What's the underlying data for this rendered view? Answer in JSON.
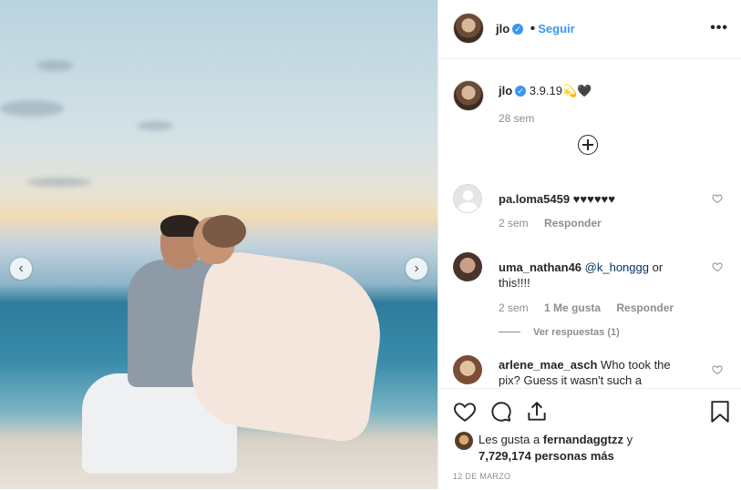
{
  "post": {
    "author": "jlo",
    "follow_label": "Seguir",
    "more_label": "•••",
    "caption": "3.9.19💫🖤",
    "caption_age": "28 sem",
    "prev_arrow": "‹",
    "next_arrow": "›"
  },
  "comments": [
    {
      "username": "pa.loma5459",
      "text": "♥♥♥♥♥♥",
      "age": "2 sem",
      "likes": "",
      "reply_label": "Responder"
    },
    {
      "username": "uma_nathan46",
      "mention": "@k_honggg",
      "text": "or this!!!!",
      "age": "2 sem",
      "likes": "1 Me gusta",
      "reply_label": "Responder",
      "view_replies": "Ver respuestas (1)"
    },
    {
      "username": "arlene_mae_asch",
      "text": "Who took the pix? Guess it wasn't such a",
      "age": "",
      "likes": "",
      "reply_label": ""
    }
  ],
  "footer": {
    "liked_prefix": "Les gusta a",
    "liked_user": "fernandaggtzz",
    "liked_conj": "y",
    "liked_count": "7,729,174 personas más",
    "date": "12 DE MARZO"
  },
  "colors": {
    "accent": "#3897f0",
    "text": "#262626",
    "muted": "#8e8e8e"
  }
}
